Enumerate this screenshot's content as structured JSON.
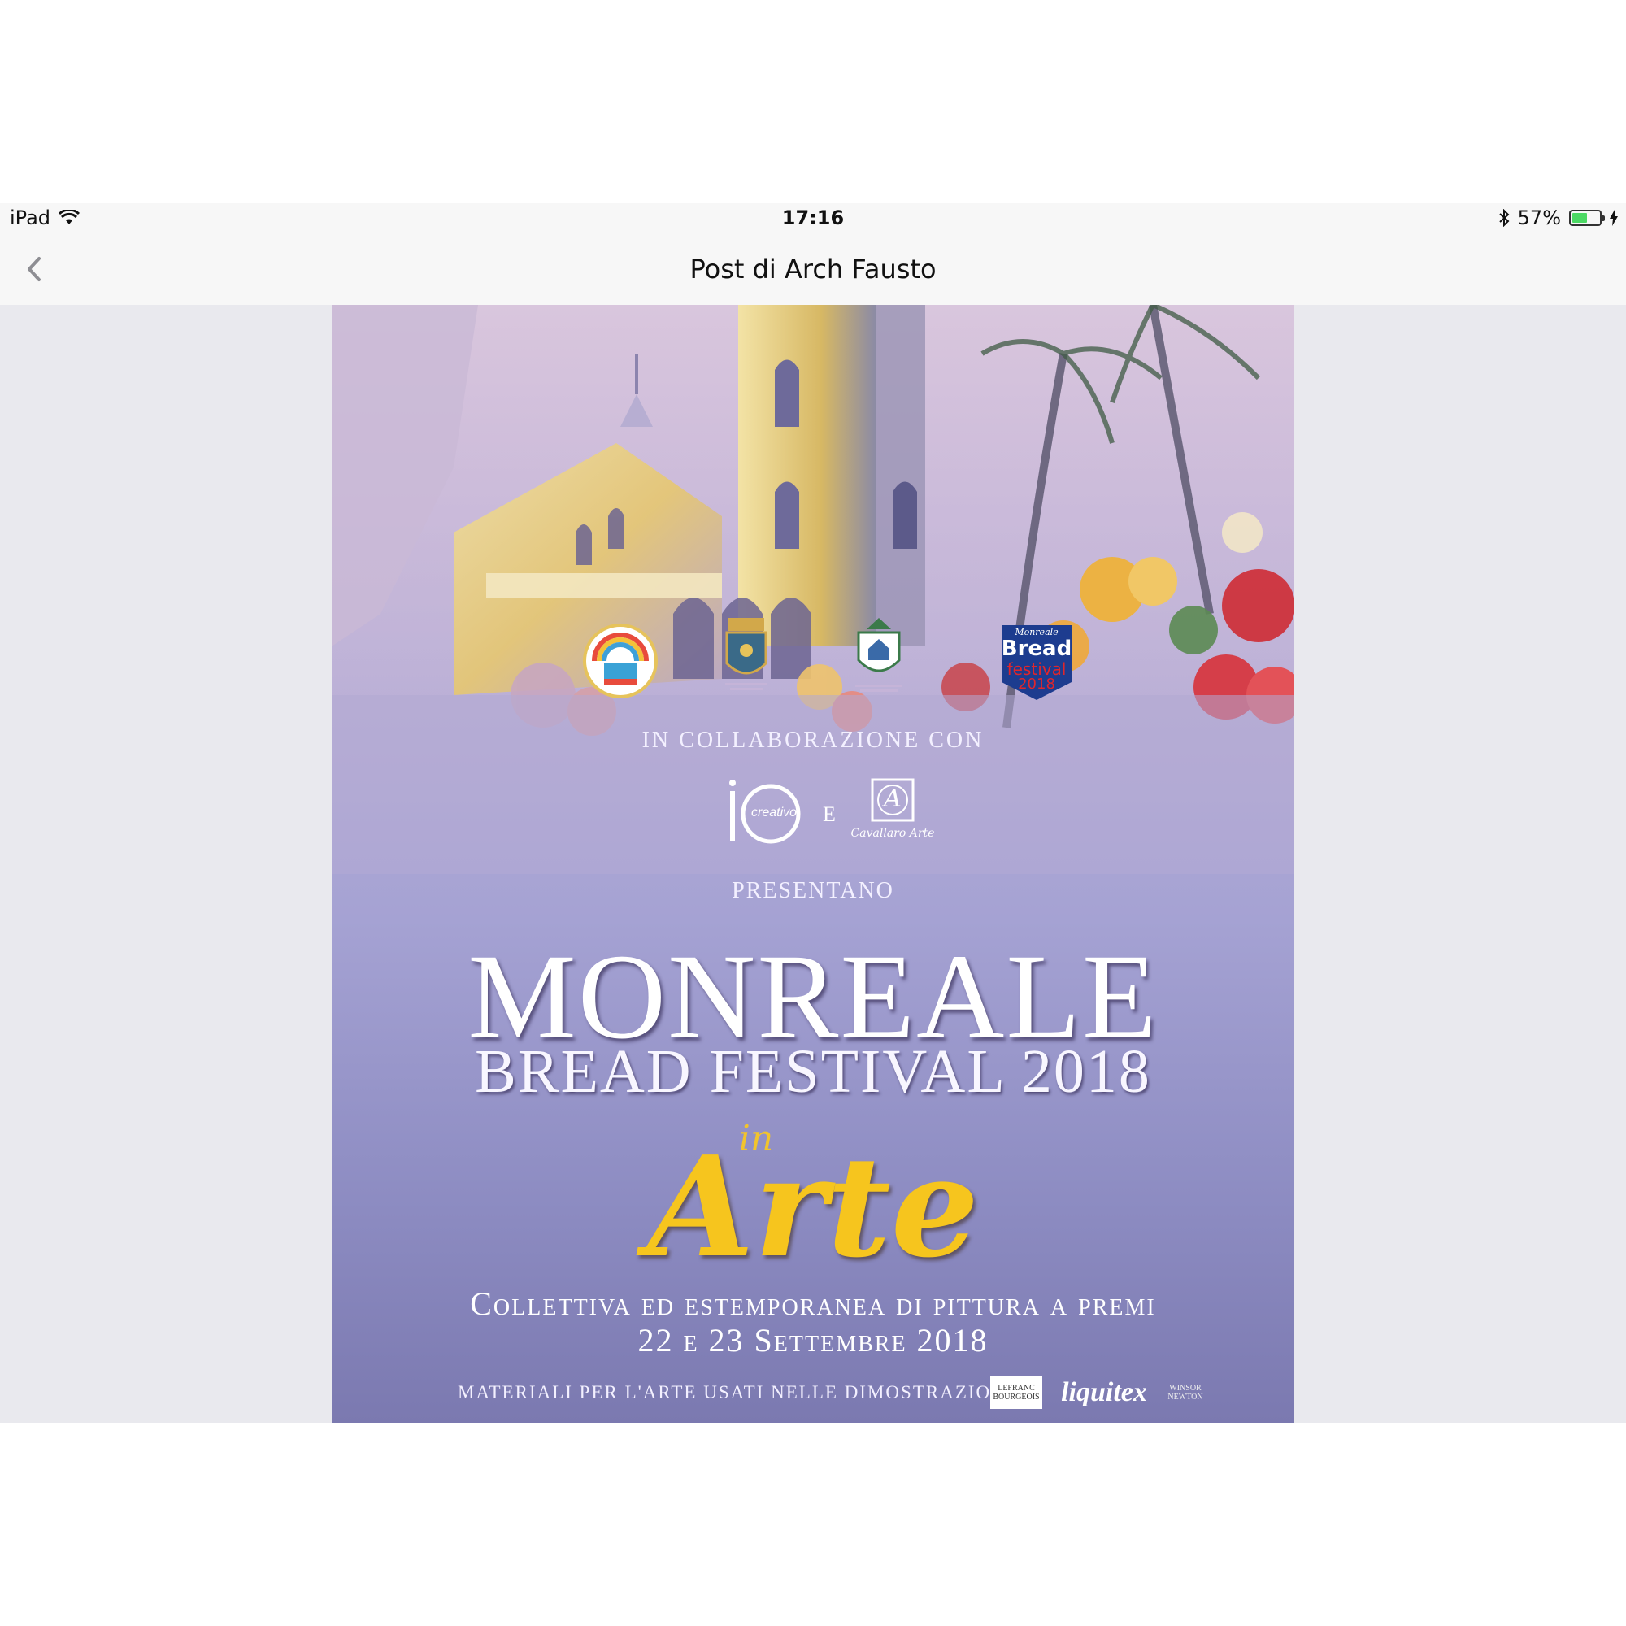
{
  "status_bar": {
    "device": "iPad",
    "time": "17:16",
    "battery_percent_label": "57%",
    "battery_level": 0.57,
    "icons": [
      "wifi-icon",
      "bluetooth-icon",
      "battery-icon",
      "charging-icon"
    ]
  },
  "nav": {
    "title": "Post di Arch Fausto",
    "back_icon": "chevron-left-icon"
  },
  "poster": {
    "collaboration": "IN COLLABORAZIONE CON",
    "e_connector": "E",
    "presentano": "PRESENTANO",
    "title": "MONREALE",
    "subtitle": "BREAD FESTIVAL 2018",
    "in_word": "in",
    "arte_word": "Arte",
    "description_line1": "Collettiva ed estemporanea di pittura a premi",
    "description_line2": "22 e 23 Settembre 2018",
    "materials": "MATERIALI PER L'ARTE USATI NELLE DIMOSTRAZIONI",
    "logos": {
      "bread_festival": {
        "line1": "Monreale",
        "line2": "Bread",
        "line3": "festival",
        "line4": "2018"
      },
      "io_creativo": {
        "io": "io",
        "creativo": "creativo"
      },
      "cavallaro": {
        "mark": "A",
        "name": "Cavallaro Arte"
      },
      "lefranc": {
        "line1": "LEFRANC",
        "line2": "BOURGEOIS"
      },
      "liquitex": "liquitex",
      "winsor": {
        "line1": "WINSOR",
        "line2": "NEWTON"
      }
    },
    "colors": {
      "background_top": "#c9b7d9",
      "background_bottom": "#7b79b0",
      "arte_yellow": "#f6c51e",
      "bread_logo_blue": "#1d3c8f",
      "bread_logo_red": "#e0262b"
    }
  }
}
